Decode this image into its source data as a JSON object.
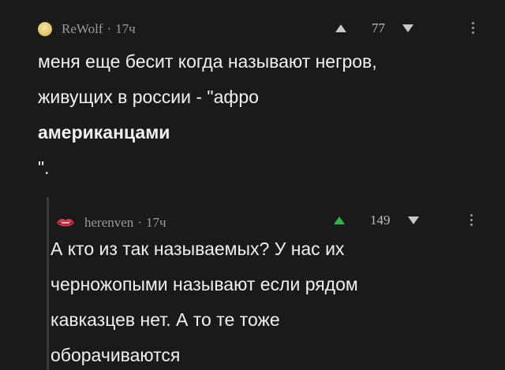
{
  "comments": [
    {
      "author": "ReWolf",
      "time": "17ч",
      "score": "77",
      "lines": [
        "меня еще бесит когда называют негров,",
        "живущих в россии - \"афро",
        "американцами",
        "\"."
      ]
    },
    {
      "author": "herenven",
      "time": "17ч",
      "score": "149",
      "lines": [
        "А кто из так называемых? У нас их",
        "черножопыми называют если рядом",
        "кавказцев нет. А то те тоже",
        "оборачиваются"
      ]
    }
  ],
  "separator": "·",
  "colors": {
    "background": "#1a1a1b",
    "upvote_active": "#2fb34a"
  },
  "icons": {
    "upvote": "triangle-up-icon",
    "downvote": "triangle-down-icon",
    "more": "kebab-menu-icon"
  }
}
